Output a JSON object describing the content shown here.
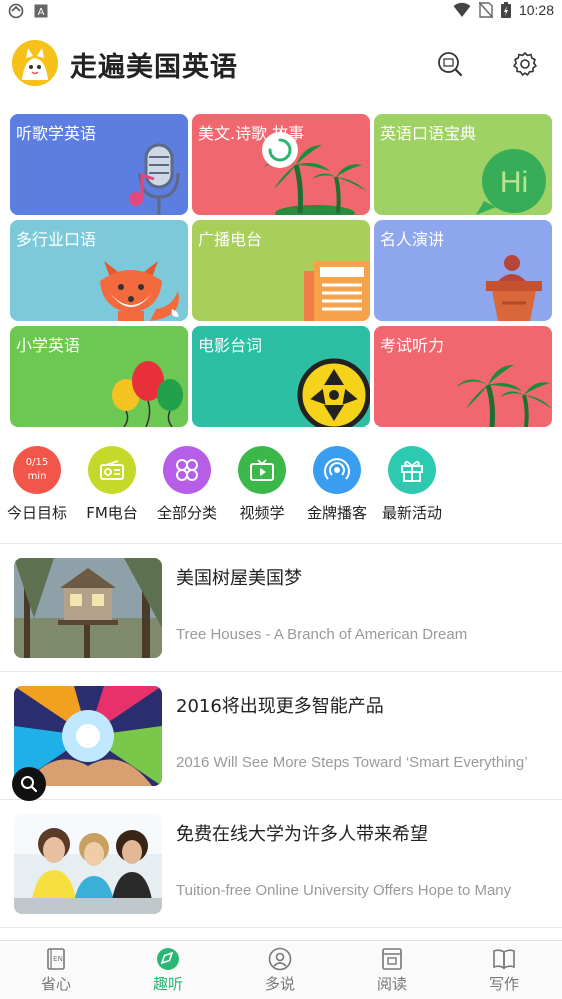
{
  "status_bar": {
    "time": "10:28"
  },
  "header": {
    "title": "走遍美国英语"
  },
  "categories": [
    {
      "label": "听歌学英语",
      "color": "#5b7ee0"
    },
    {
      "label": "美文.诗歌.故事",
      "color": "#f0676f"
    },
    {
      "label": "英语口语宝典",
      "color": "#9ed265"
    },
    {
      "label": "多行业口语",
      "color": "#7ccad9"
    },
    {
      "label": "广播电台",
      "color": "#a8cf5a"
    },
    {
      "label": "名人演讲",
      "color": "#8ea6ee"
    },
    {
      "label": "小学英语",
      "color": "#6cc753"
    },
    {
      "label": "电影台词",
      "color": "#2cbfa3"
    },
    {
      "label": "考试听力",
      "color": "#f0676f"
    }
  ],
  "tile_badge": "Hi",
  "quick_actions": {
    "goal": {
      "progress": "0/15",
      "unit": "min",
      "label": "今日目标"
    },
    "fm": {
      "label": "FM电台"
    },
    "all": {
      "label": "全部分类"
    },
    "video": {
      "label": "视频学"
    },
    "podcast": {
      "label": "金牌播客"
    },
    "events": {
      "label": "最新活动"
    }
  },
  "articles": [
    {
      "title": "美国树屋美国梦",
      "subtitle": "Tree Houses - A Branch of American Dream"
    },
    {
      "title": "2016将出现更多智能产品",
      "subtitle": "2016 Will See More Steps Toward ‘Smart Everything’"
    },
    {
      "title": "免费在线大学为许多人带来希望",
      "subtitle": "Tuition-free Online University Offers Hope to Many"
    }
  ],
  "bottom_nav": [
    {
      "label": "省心",
      "icon": "book-en-icon"
    },
    {
      "label": "趣听",
      "icon": "compass-icon",
      "active": true
    },
    {
      "label": "多说",
      "icon": "person-icon"
    },
    {
      "label": "阅读",
      "icon": "reader-icon"
    },
    {
      "label": "写作",
      "icon": "open-book-icon"
    }
  ],
  "colors": {
    "accent": "#2bb673"
  }
}
